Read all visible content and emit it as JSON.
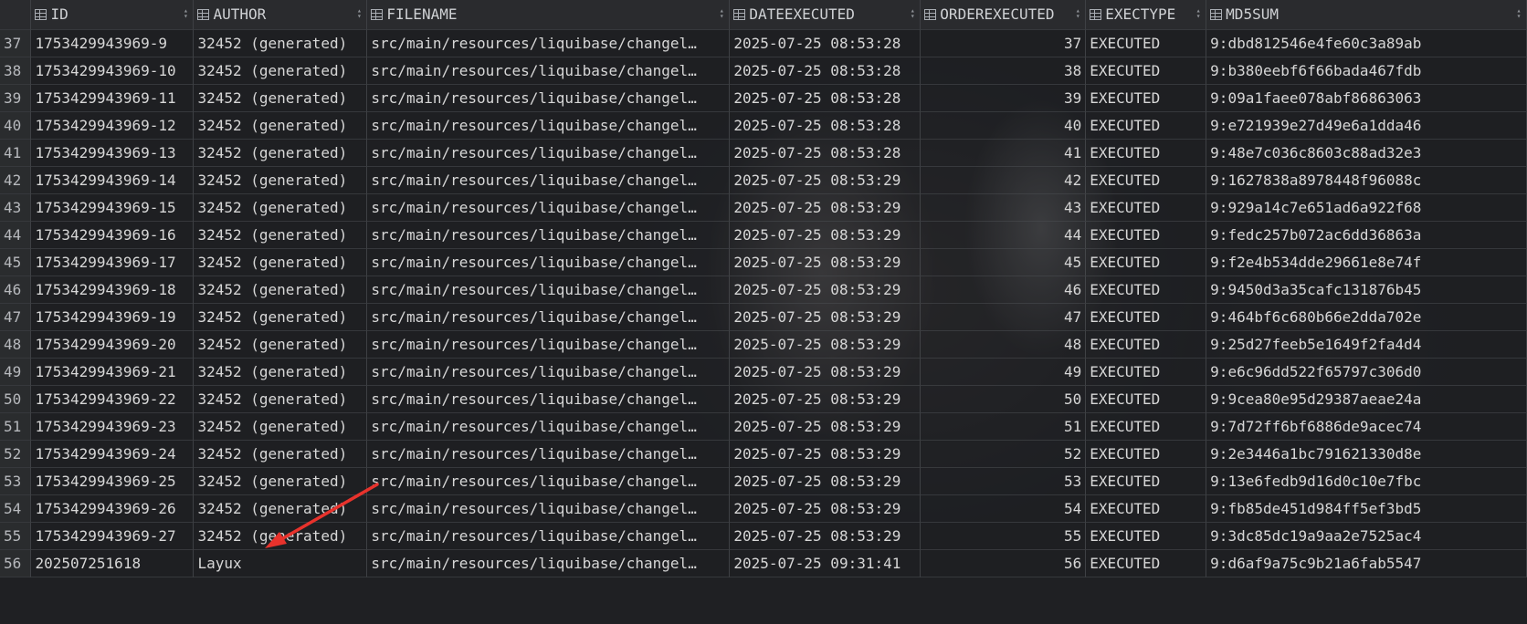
{
  "columns": [
    {
      "key": "rownum",
      "label": ""
    },
    {
      "key": "id",
      "label": "ID"
    },
    {
      "key": "author",
      "label": "AUTHOR"
    },
    {
      "key": "filename",
      "label": "FILENAME"
    },
    {
      "key": "dateexecuted",
      "label": "DATEEXECUTED"
    },
    {
      "key": "orderexecuted",
      "label": "ORDEREXECUTED"
    },
    {
      "key": "exectype",
      "label": "EXECTYPE"
    },
    {
      "key": "md5sum",
      "label": "MD5SUM"
    }
  ],
  "rows": [
    {
      "rownum": "37",
      "id": "1753429943969-9",
      "author": "32452 (generated)",
      "filename": "src/main/resources/liquibase/changel…",
      "dateexecuted": "2025-07-25 08:53:28",
      "orderexecuted": "37",
      "exectype": "EXECUTED",
      "md5sum": "9:dbd812546e4fe60c3a89ab"
    },
    {
      "rownum": "38",
      "id": "1753429943969-10",
      "author": "32452 (generated)",
      "filename": "src/main/resources/liquibase/changel…",
      "dateexecuted": "2025-07-25 08:53:28",
      "orderexecuted": "38",
      "exectype": "EXECUTED",
      "md5sum": "9:b380eebf6f66bada467fdb"
    },
    {
      "rownum": "39",
      "id": "1753429943969-11",
      "author": "32452 (generated)",
      "filename": "src/main/resources/liquibase/changel…",
      "dateexecuted": "2025-07-25 08:53:28",
      "orderexecuted": "39",
      "exectype": "EXECUTED",
      "md5sum": "9:09a1faee078abf86863063"
    },
    {
      "rownum": "40",
      "id": "1753429943969-12",
      "author": "32452 (generated)",
      "filename": "src/main/resources/liquibase/changel…",
      "dateexecuted": "2025-07-25 08:53:28",
      "orderexecuted": "40",
      "exectype": "EXECUTED",
      "md5sum": "9:e721939e27d49e6a1dda46"
    },
    {
      "rownum": "41",
      "id": "1753429943969-13",
      "author": "32452 (generated)",
      "filename": "src/main/resources/liquibase/changel…",
      "dateexecuted": "2025-07-25 08:53:28",
      "orderexecuted": "41",
      "exectype": "EXECUTED",
      "md5sum": "9:48e7c036c8603c88ad32e3"
    },
    {
      "rownum": "42",
      "id": "1753429943969-14",
      "author": "32452 (generated)",
      "filename": "src/main/resources/liquibase/changel…",
      "dateexecuted": "2025-07-25 08:53:29",
      "orderexecuted": "42",
      "exectype": "EXECUTED",
      "md5sum": "9:1627838a8978448f96088c"
    },
    {
      "rownum": "43",
      "id": "1753429943969-15",
      "author": "32452 (generated)",
      "filename": "src/main/resources/liquibase/changel…",
      "dateexecuted": "2025-07-25 08:53:29",
      "orderexecuted": "43",
      "exectype": "EXECUTED",
      "md5sum": "9:929a14c7e651ad6a922f68"
    },
    {
      "rownum": "44",
      "id": "1753429943969-16",
      "author": "32452 (generated)",
      "filename": "src/main/resources/liquibase/changel…",
      "dateexecuted": "2025-07-25 08:53:29",
      "orderexecuted": "44",
      "exectype": "EXECUTED",
      "md5sum": "9:fedc257b072ac6dd36863a"
    },
    {
      "rownum": "45",
      "id": "1753429943969-17",
      "author": "32452 (generated)",
      "filename": "src/main/resources/liquibase/changel…",
      "dateexecuted": "2025-07-25 08:53:29",
      "orderexecuted": "45",
      "exectype": "EXECUTED",
      "md5sum": "9:f2e4b534dde29661e8e74f"
    },
    {
      "rownum": "46",
      "id": "1753429943969-18",
      "author": "32452 (generated)",
      "filename": "src/main/resources/liquibase/changel…",
      "dateexecuted": "2025-07-25 08:53:29",
      "orderexecuted": "46",
      "exectype": "EXECUTED",
      "md5sum": "9:9450d3a35cafc131876b45"
    },
    {
      "rownum": "47",
      "id": "1753429943969-19",
      "author": "32452 (generated)",
      "filename": "src/main/resources/liquibase/changel…",
      "dateexecuted": "2025-07-25 08:53:29",
      "orderexecuted": "47",
      "exectype": "EXECUTED",
      "md5sum": "9:464bf6c680b66e2dda702e"
    },
    {
      "rownum": "48",
      "id": "1753429943969-20",
      "author": "32452 (generated)",
      "filename": "src/main/resources/liquibase/changel…",
      "dateexecuted": "2025-07-25 08:53:29",
      "orderexecuted": "48",
      "exectype": "EXECUTED",
      "md5sum": "9:25d27feeb5e1649f2fa4d4"
    },
    {
      "rownum": "49",
      "id": "1753429943969-21",
      "author": "32452 (generated)",
      "filename": "src/main/resources/liquibase/changel…",
      "dateexecuted": "2025-07-25 08:53:29",
      "orderexecuted": "49",
      "exectype": "EXECUTED",
      "md5sum": "9:e6c96dd522f65797c306d0"
    },
    {
      "rownum": "50",
      "id": "1753429943969-22",
      "author": "32452 (generated)",
      "filename": "src/main/resources/liquibase/changel…",
      "dateexecuted": "2025-07-25 08:53:29",
      "orderexecuted": "50",
      "exectype": "EXECUTED",
      "md5sum": "9:9cea80e95d29387aeae24a"
    },
    {
      "rownum": "51",
      "id": "1753429943969-23",
      "author": "32452 (generated)",
      "filename": "src/main/resources/liquibase/changel…",
      "dateexecuted": "2025-07-25 08:53:29",
      "orderexecuted": "51",
      "exectype": "EXECUTED",
      "md5sum": "9:7d72ff6bf6886de9acec74"
    },
    {
      "rownum": "52",
      "id": "1753429943969-24",
      "author": "32452 (generated)",
      "filename": "src/main/resources/liquibase/changel…",
      "dateexecuted": "2025-07-25 08:53:29",
      "orderexecuted": "52",
      "exectype": "EXECUTED",
      "md5sum": "9:2e3446a1bc791621330d8e"
    },
    {
      "rownum": "53",
      "id": "1753429943969-25",
      "author": "32452 (generated)",
      "filename": "src/main/resources/liquibase/changel…",
      "dateexecuted": "2025-07-25 08:53:29",
      "orderexecuted": "53",
      "exectype": "EXECUTED",
      "md5sum": "9:13e6fedb9d16d0c10e7fbc"
    },
    {
      "rownum": "54",
      "id": "1753429943969-26",
      "author": "32452 (generated)",
      "filename": "src/main/resources/liquibase/changel…",
      "dateexecuted": "2025-07-25 08:53:29",
      "orderexecuted": "54",
      "exectype": "EXECUTED",
      "md5sum": "9:fb85de451d984ff5ef3bd5"
    },
    {
      "rownum": "55",
      "id": "1753429943969-27",
      "author": "32452 (generated)",
      "filename": "src/main/resources/liquibase/changel…",
      "dateexecuted": "2025-07-25 08:53:29",
      "orderexecuted": "55",
      "exectype": "EXECUTED",
      "md5sum": "9:3dc85dc19a9aa2e7525ac4"
    },
    {
      "rownum": "56",
      "id": "202507251618",
      "author": "Layux",
      "filename": "src/main/resources/liquibase/changel…",
      "dateexecuted": "2025-07-25 09:31:41",
      "orderexecuted": "56",
      "exectype": "EXECUTED",
      "md5sum": "9:d6af9a75c9b21a6fab5547"
    }
  ],
  "colors": {
    "background": "#1f2023",
    "header_bg": "#2b2d30",
    "text": "#d7d7d7",
    "annotation_arrow": "#e8322c"
  },
  "icons": {
    "column_header": "table-column-icon",
    "sort": "sort-toggle-icon",
    "annotation": "red-arrow-icon"
  }
}
